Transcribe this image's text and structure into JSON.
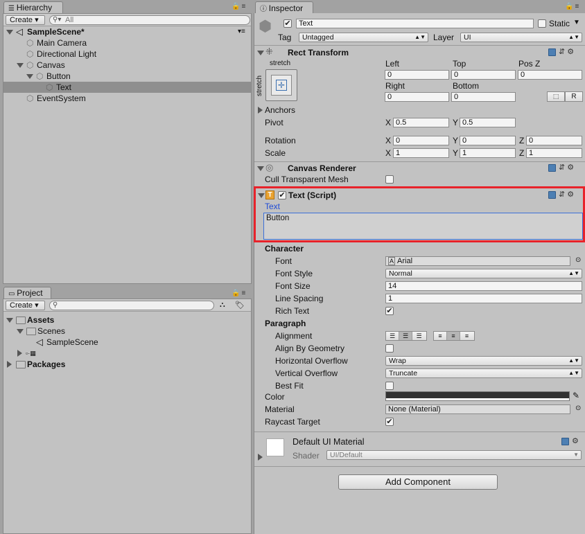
{
  "hierarchy": {
    "tab_label": "Hierarchy",
    "create_label": "Create",
    "search_placeholder": "All",
    "scene_name": "SampleScene*",
    "items": [
      {
        "label": "Main Camera"
      },
      {
        "label": "Directional Light"
      },
      {
        "label": "Canvas"
      },
      {
        "label": "Button"
      },
      {
        "label": "Text"
      },
      {
        "label": "EventSystem"
      }
    ]
  },
  "project": {
    "tab_label": "Project",
    "create_label": "Create",
    "assets_label": "Assets",
    "scenes_label": "Scenes",
    "scene_file": "SampleScene",
    "packages_label": "Packages"
  },
  "inspector": {
    "tab_label": "Inspector",
    "object_name": "Text",
    "static_label": "Static",
    "tag_label": "Tag",
    "tag_value": "Untagged",
    "layer_label": "Layer",
    "layer_value": "UI",
    "rect_transform": {
      "title": "Rect Transform",
      "preset_label": "stretch",
      "preset_side_label": "stretch",
      "left_label": "Left",
      "left_value": "0",
      "top_label": "Top",
      "top_value": "0",
      "posz_label": "Pos Z",
      "posz_value": "0",
      "right_label": "Right",
      "right_value": "0",
      "bottom_label": "Bottom",
      "bottom_value": "0",
      "r_label": "R",
      "anchors_label": "Anchors",
      "pivot_label": "Pivot",
      "pivot_x": "0.5",
      "pivot_y": "0.5",
      "rotation_label": "Rotation",
      "rot_x": "0",
      "rot_y": "0",
      "rot_z": "0",
      "scale_label": "Scale",
      "scale_x": "1",
      "scale_y": "1",
      "scale_z": "1",
      "x_label": "X",
      "y_label": "Y",
      "z_label": "Z"
    },
    "canvas_renderer": {
      "title": "Canvas Renderer",
      "cull_label": "Cull Transparent Mesh"
    },
    "text_script": {
      "title": "Text (Script)",
      "text_label": "Text",
      "text_value": "Button",
      "character_label": "Character",
      "font_label": "Font",
      "font_value": "Arial",
      "font_style_label": "Font Style",
      "font_style_value": "Normal",
      "font_size_label": "Font Size",
      "font_size_value": "14",
      "line_spacing_label": "Line Spacing",
      "line_spacing_value": "1",
      "rich_text_label": "Rich Text",
      "paragraph_label": "Paragraph",
      "alignment_label": "Alignment",
      "align_geometry_label": "Align By Geometry",
      "h_overflow_label": "Horizontal Overflow",
      "h_overflow_value": "Wrap",
      "v_overflow_label": "Vertical Overflow",
      "v_overflow_value": "Truncate",
      "best_fit_label": "Best Fit",
      "color_label": "Color",
      "material_label": "Material",
      "material_value": "None (Material)",
      "raycast_label": "Raycast Target"
    },
    "material": {
      "name": "Default UI Material",
      "shader_label": "Shader",
      "shader_value": "UI/Default"
    },
    "add_component_label": "Add Component",
    "highlight_color": "#e8222a"
  }
}
